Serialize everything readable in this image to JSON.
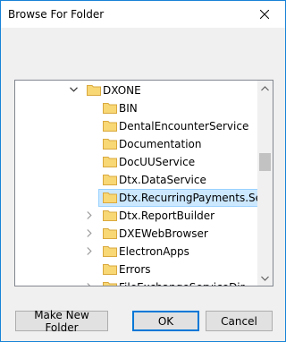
{
  "dialog": {
    "title": "Browse For Folder",
    "close_icon": "close-icon"
  },
  "tree": {
    "items": [
      {
        "label": "DXONE",
        "expander": "expanded",
        "indent": 1,
        "selected": false
      },
      {
        "label": "BIN",
        "expander": "none",
        "indent": 2,
        "selected": false
      },
      {
        "label": "DentalEncounterService",
        "expander": "none",
        "indent": 2,
        "selected": false
      },
      {
        "label": "Documentation",
        "expander": "none",
        "indent": 2,
        "selected": false
      },
      {
        "label": "DocUUService",
        "expander": "none",
        "indent": 2,
        "selected": false
      },
      {
        "label": "Dtx.DataService",
        "expander": "none",
        "indent": 2,
        "selected": false
      },
      {
        "label": "Dtx.RecurringPayments.Servi",
        "expander": "none",
        "indent": 2,
        "selected": true
      },
      {
        "label": "Dtx.ReportBuilder",
        "expander": "collapsed",
        "indent": 2,
        "selected": false
      },
      {
        "label": "DXEWebBrowser",
        "expander": "collapsed",
        "indent": 2,
        "selected": false
      },
      {
        "label": "ElectronApps",
        "expander": "collapsed",
        "indent": 2,
        "selected": false
      },
      {
        "label": "Errors",
        "expander": "none",
        "indent": 2,
        "selected": false
      },
      {
        "label": "FileExchangeServiceDir",
        "expander": "collapsed",
        "indent": 2,
        "selected": false
      }
    ]
  },
  "buttons": {
    "make_new_folder": "Make New Folder",
    "ok": "OK",
    "cancel": "Cancel"
  },
  "colors": {
    "selection_bg": "#cce8ff",
    "selection_border": "#99d1ff",
    "folder": "#f8d775",
    "window_border": "#1883d7"
  }
}
